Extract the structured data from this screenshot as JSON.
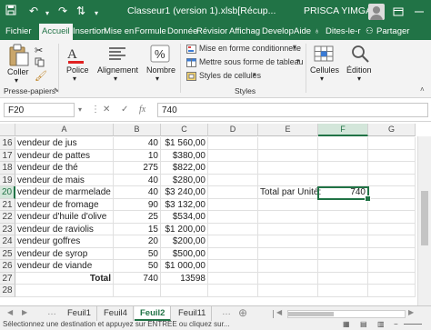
{
  "titlebar": {
    "document_title": "Classeur1 (version 1).xlsb[Récup...",
    "user_name": "PRISCA YIMGA",
    "save_icon": "save-icon",
    "undo_icon": "undo-icon",
    "redo_icon": "redo-icon",
    "customize_icon": "customize-quick-access-icon",
    "bg_color": "#217346"
  },
  "tabs": [
    "Fichier",
    "Accueil",
    "Insertion",
    "Mise en",
    "Formule",
    "Donnée",
    "Révisior",
    "Affichag",
    "Develop",
    "Aide"
  ],
  "tabs_active": "Accueil",
  "tell_me": "Dites-le-r",
  "share_label": "Partager",
  "ribbon": {
    "paste_label": "Coller",
    "clipboard_group": "Presse-papiers",
    "font_label": "Police",
    "alignment_label": "Alignement",
    "number_label": "Nombre",
    "cond_format": "Mise en forme conditionnelle",
    "format_table": "Mettre sous forme de tableau",
    "cell_styles": "Styles de cellules",
    "styles_group": "Styles",
    "cells_label": "Cellules",
    "editing_label": "Édition"
  },
  "formula_bar": {
    "name_box": "F20",
    "cancel": "✕",
    "enter": "✓",
    "fx": "fx",
    "value": "740"
  },
  "grid": {
    "columns": [
      "A",
      "B",
      "C",
      "D",
      "E",
      "F",
      "G"
    ],
    "selected_column": "F",
    "selected_row": "20",
    "rows": [
      {
        "n": "16",
        "a": "vendeur de jus",
        "b": "40",
        "c": "$1 560,00",
        "e": "",
        "f": ""
      },
      {
        "n": "17",
        "a": "vendeur de pattes",
        "b": "10",
        "c": "$380,00",
        "e": "",
        "f": ""
      },
      {
        "n": "18",
        "a": "vendeur de thé",
        "b": "275",
        "c": "$822,00",
        "e": "",
        "f": ""
      },
      {
        "n": "19",
        "a": "vendeur de mais",
        "b": "40",
        "c": "$280,00",
        "e": "",
        "f": ""
      },
      {
        "n": "20",
        "a": "vendeur de marmelade",
        "b": "40",
        "c": "$3 240,00",
        "e": "Total par Unité:",
        "f": "740"
      },
      {
        "n": "21",
        "a": "vendeur de fromage",
        "b": "90",
        "c": "$3 132,00",
        "e": "",
        "f": ""
      },
      {
        "n": "22",
        "a": "vendeur d'huile d'olive",
        "b": "25",
        "c": "$534,00",
        "e": "",
        "f": ""
      },
      {
        "n": "23",
        "a": "vendeur de raviolis",
        "b": "15",
        "c": "$1 200,00",
        "e": "",
        "f": ""
      },
      {
        "n": "24",
        "a": "vendeur goffres",
        "b": "20",
        "c": "$200,00",
        "e": "",
        "f": ""
      },
      {
        "n": "25",
        "a": "vendeur de syrop",
        "b": "50",
        "c": "$500,00",
        "e": "",
        "f": ""
      },
      {
        "n": "26",
        "a": "vendeur de viande",
        "b": "50",
        "c": "$1 000,00",
        "e": "",
        "f": ""
      },
      {
        "n": "27",
        "a": "Total",
        "b": "740",
        "c": "13598",
        "e": "",
        "f": ""
      },
      {
        "n": "28",
        "a": "",
        "b": "",
        "c": "",
        "e": "",
        "f": ""
      }
    ]
  },
  "sheets": [
    "Feuil1",
    "Feuil4",
    "Feuil2",
    "Feuil11"
  ],
  "sheets_active": "Feuil2",
  "status_message": "Sélectionnez une destination et appuyez sur ENTRÉE ou cliquez sur..."
}
